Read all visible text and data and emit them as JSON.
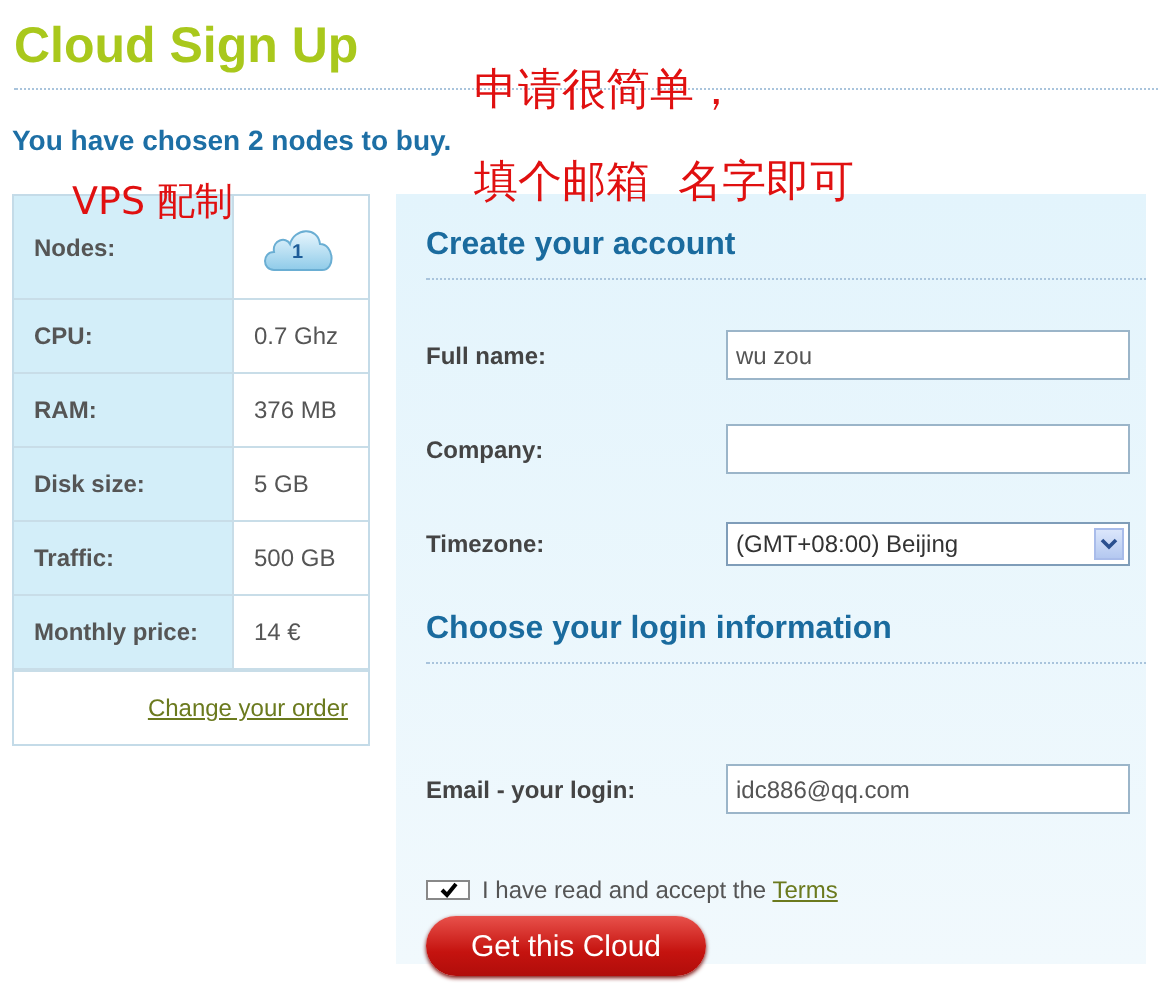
{
  "title": "Cloud Sign Up",
  "subtitle": "You have chosen 2 nodes to buy.",
  "annotations": [
    {
      "text": "申请很简单，"
    },
    {
      "text": "填个邮箱  名字即可"
    },
    {
      "text": "VPS 配制"
    }
  ],
  "order": {
    "rows": [
      {
        "label": "Nodes:",
        "kind": "nodes",
        "value": "1"
      },
      {
        "label": "CPU:",
        "kind": "text",
        "value": "0.7 Ghz"
      },
      {
        "label": "RAM:",
        "kind": "text",
        "value": "376 MB"
      },
      {
        "label": "Disk size:",
        "kind": "text",
        "value": "5 GB"
      },
      {
        "label": "Traffic:",
        "kind": "text",
        "value": "500 GB"
      },
      {
        "label": "Monthly price:",
        "kind": "text",
        "value": "14 €"
      }
    ],
    "change_link": "Change your order"
  },
  "sections": [
    {
      "heading": "Create your account",
      "fields": [
        {
          "label": "Full name:",
          "kind": "text",
          "value": "wu zou"
        },
        {
          "label": "Company:",
          "kind": "text"
        },
        {
          "label": "Timezone:",
          "kind": "select",
          "value": "(GMT+08:00) Beijing"
        }
      ]
    },
    {
      "heading": "Choose your login information",
      "fields": [
        {
          "label": "Email - your login:",
          "kind": "text",
          "value": "idc886@qq.com"
        }
      ]
    }
  ],
  "terms": {
    "checked": true,
    "text": "I have read and accept the ",
    "link": "Terms"
  },
  "submit": "Get this Cloud"
}
